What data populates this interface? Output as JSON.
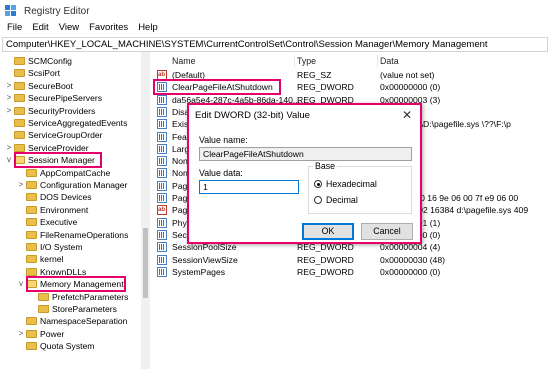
{
  "window": {
    "title": "Registry Editor"
  },
  "menu": [
    "File",
    "Edit",
    "View",
    "Favorites",
    "Help"
  ],
  "address": "Computer\\HKEY_LOCAL_MACHINE\\SYSTEM\\CurrentControlSet\\Control\\Session Manager\\Memory Management",
  "tree": [
    {
      "label": "SCMConfig",
      "level": 0,
      "expander": "",
      "open": false
    },
    {
      "label": "ScsiPort",
      "level": 0,
      "expander": "",
      "open": false
    },
    {
      "label": "SecureBoot",
      "level": 0,
      "expander": ">",
      "open": false
    },
    {
      "label": "SecurePipeServers",
      "level": 0,
      "expander": ">",
      "open": false
    },
    {
      "label": "SecurityProviders",
      "level": 0,
      "expander": ">",
      "open": false
    },
    {
      "label": "ServiceAggregatedEvents",
      "level": 0,
      "expander": "",
      "open": false
    },
    {
      "label": "ServiceGroupOrder",
      "level": 0,
      "expander": "",
      "open": false
    },
    {
      "label": "ServiceProvider",
      "level": 0,
      "expander": ">",
      "open": false
    },
    {
      "label": "Session Manager",
      "level": 0,
      "expander": "v",
      "open": true,
      "highlight": true
    },
    {
      "label": "AppCompatCache",
      "level": 1,
      "expander": "",
      "open": false
    },
    {
      "label": "Configuration Manager",
      "level": 1,
      "expander": ">",
      "open": false
    },
    {
      "label": "DOS Devices",
      "level": 1,
      "expander": "",
      "open": false
    },
    {
      "label": "Environment",
      "level": 1,
      "expander": "",
      "open": false
    },
    {
      "label": "Executive",
      "level": 1,
      "expander": "",
      "open": false
    },
    {
      "label": "FileRenameOperations",
      "level": 1,
      "expander": "",
      "open": false
    },
    {
      "label": "I/O System",
      "level": 1,
      "expander": "",
      "open": false
    },
    {
      "label": "kernel",
      "level": 1,
      "expander": "",
      "open": false
    },
    {
      "label": "KnownDLLs",
      "level": 1,
      "expander": "",
      "open": false
    },
    {
      "label": "Memory Management",
      "level": 1,
      "expander": "v",
      "open": true,
      "highlight": true
    },
    {
      "label": "PrefetchParameters",
      "level": 2,
      "expander": "",
      "open": false
    },
    {
      "label": "StoreParameters",
      "level": 2,
      "expander": "",
      "open": false
    },
    {
      "label": "NamespaceSeparation",
      "level": 1,
      "expander": "",
      "open": false
    },
    {
      "label": "Power",
      "level": 1,
      "expander": ">",
      "open": false
    },
    {
      "label": "Quota System",
      "level": 1,
      "expander": "",
      "open": false
    }
  ],
  "columns": {
    "name": "Name",
    "type": "Type",
    "data": "Data"
  },
  "values": [
    {
      "icon": "sz",
      "name": "(Default)",
      "type": "REG_SZ",
      "data": "(value not set)"
    },
    {
      "icon": "bin",
      "name": "ClearPageFileAtShutdown",
      "type": "REG_DWORD",
      "data": "0x00000000 (0)",
      "highlight": true
    },
    {
      "icon": "bin",
      "name": "da56a5e4-287c-4a5b-86da-140...",
      "type": "REG_DWORD",
      "data": "0x00000003 (3)"
    },
    {
      "icon": "bin",
      "name": "Disab",
      "type": "",
      "data": ""
    },
    {
      "icon": "bin",
      "name": "Existi",
      "type": "",
      "data": "file.sys \\??\\D:\\pagefile.sys \\??\\F:\\p"
    },
    {
      "icon": "bin",
      "name": "Featu",
      "type": "",
      "data": ""
    },
    {
      "icon": "bin",
      "name": "Large",
      "type": "",
      "data": ""
    },
    {
      "icon": "bin",
      "name": "NonP",
      "type": "",
      "data": ""
    },
    {
      "icon": "bin",
      "name": "NonP",
      "type": "",
      "data": ""
    },
    {
      "icon": "bin",
      "name": "Page",
      "type": "",
      "data": ""
    },
    {
      "icon": "bin",
      "name": "Page",
      "type": "",
      "data": "8d ac 04 00 16 9e 06 00 7f e9 06 00"
    },
    {
      "icon": "sz",
      "name": "Pagi",
      "type": "",
      "data": "file.sys 8192 16384 d:\\pagefile.sys 409"
    },
    {
      "icon": "bin",
      "name": "PhysicalAddressExtension",
      "type": "REG_DWORD",
      "data": "0x00000001 (1)"
    },
    {
      "icon": "bin",
      "name": "SecondLevelDataCache",
      "type": "REG_DWORD",
      "data": "0x00000000 (0)"
    },
    {
      "icon": "bin",
      "name": "SessionPoolSize",
      "type": "REG_DWORD",
      "data": "0x00000004 (4)"
    },
    {
      "icon": "bin",
      "name": "SessionViewSize",
      "type": "REG_DWORD",
      "data": "0x00000030 (48)"
    },
    {
      "icon": "bin",
      "name": "SystemPages",
      "type": "REG_DWORD",
      "data": "0x00000000 (0)"
    }
  ],
  "dialog": {
    "title": "Edit DWORD (32-bit) Value",
    "close": "✕",
    "value_name_label": "Value name:",
    "value_name": "ClearPageFileAtShutdown",
    "value_data_label": "Value data:",
    "value_data": "1",
    "base_label": "Base",
    "base_options": [
      {
        "label": "Hexadecimal",
        "selected": true
      },
      {
        "label": "Decimal",
        "selected": false
      }
    ],
    "ok_label": "OK",
    "cancel_label": "Cancel"
  },
  "colors": {
    "highlight": "#e5006d",
    "focus": "#0078d7"
  }
}
